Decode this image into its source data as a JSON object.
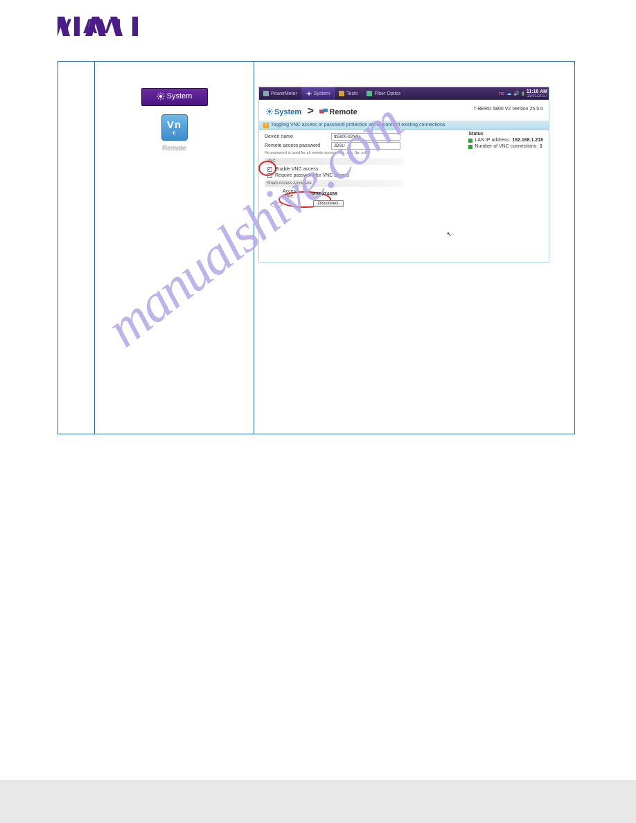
{
  "logo": "VIAVI",
  "sidebar": {
    "system_button": "System",
    "remote_icon_label": "Vnc",
    "remote_text": "Remote"
  },
  "app_bar": {
    "tabs": [
      {
        "label": "PowerMeter"
      },
      {
        "label": "System"
      },
      {
        "label": "Tests"
      },
      {
        "label": "Fiber Optics"
      }
    ],
    "nc": "nc",
    "time": "11:18 AM",
    "date": "11/01/2017"
  },
  "crumbs": {
    "system": "System",
    "sep": ">",
    "remote": "Remote",
    "version": "T-BERD 5800 V2 Version 25.5.0"
  },
  "warn": {
    "bang": "!",
    "text": "Toggling VNC access or password protection will disconnect existing connections."
  },
  "fields": {
    "device_name_label": "Device name",
    "device_name_value": "tb5800-92fe9a",
    "remote_pw_label": "Remote access password",
    "remote_pw_value": "JDSU",
    "tiny_note": "No password is used for all remote access, e.g., vnc, ftp, ssh"
  },
  "status": {
    "header": "Status",
    "ip_label": "LAN IP address:",
    "ip_value": "192.168.1.218",
    "vnc_label": "Number of VNC connections:",
    "vnc_value": "1"
  },
  "vnc_section": {
    "header": "VNC",
    "enable": "Enable VNC access",
    "require_pw": "Require password for VNC access"
  },
  "saa": {
    "header": "Smart Access Anywhere",
    "code_label": "Access code:",
    "code_value": "3838974458",
    "disconnect": "Disconnect"
  },
  "watermark": "manualshive.com"
}
